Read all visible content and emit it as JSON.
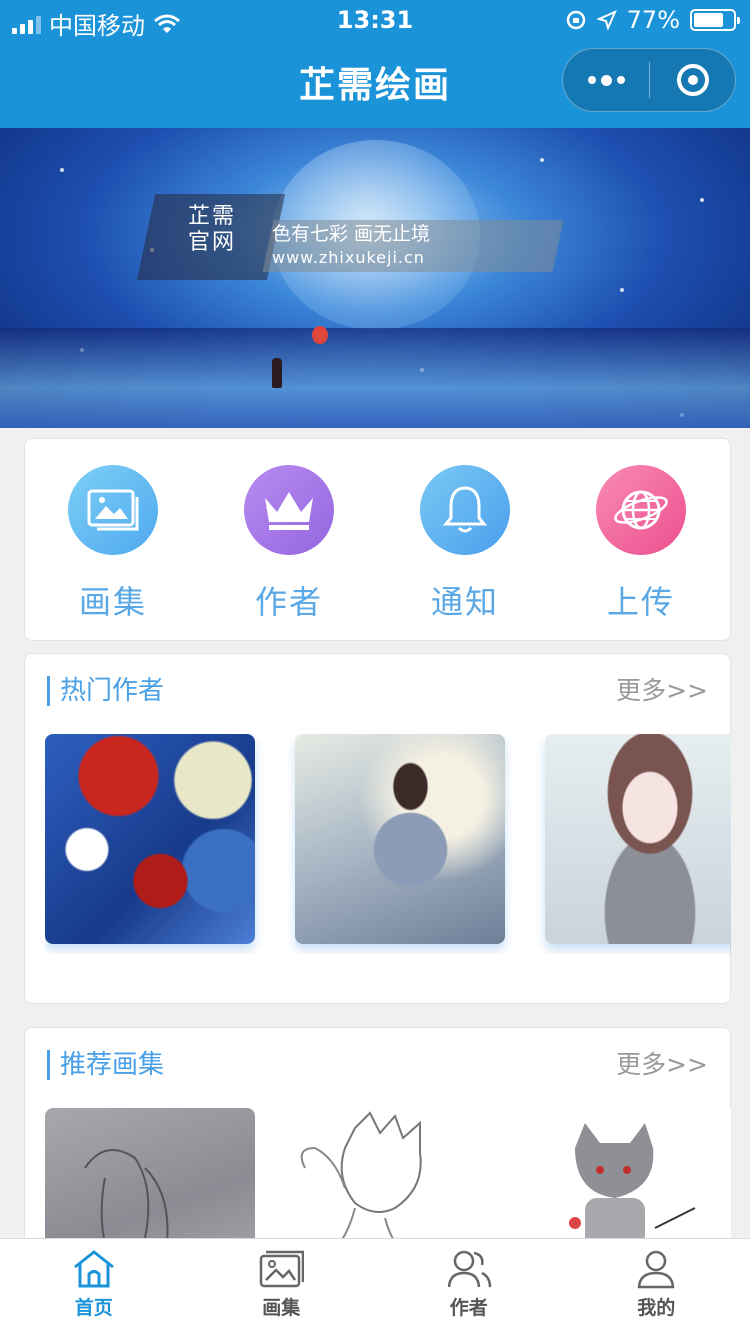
{
  "status": {
    "carrier": "中国移动",
    "time": "13:31",
    "battery": "77%",
    "battery_level": 0.77
  },
  "nav": {
    "title": "芷需绘画"
  },
  "banner": {
    "logo_line1": "芷需",
    "logo_line2": "官网",
    "slogan": "色有七彩  画无止境",
    "url": "www.zhixukeji.cn"
  },
  "menu": [
    {
      "label": "画集",
      "icon": "gallery-icon",
      "color": "#6cc3f2"
    },
    {
      "label": "作者",
      "icon": "crown-icon",
      "color": "#a77ae8"
    },
    {
      "label": "通知",
      "icon": "bell-icon",
      "color": "#5fb4f1"
    },
    {
      "label": "上传",
      "icon": "globe-icon",
      "color": "#f0679e"
    }
  ],
  "hot_authors": {
    "title": "热门作者",
    "more": "更多>>"
  },
  "recommended": {
    "title": "推荐画集",
    "more": "更多>>"
  },
  "tabs": [
    {
      "label": "首页",
      "icon": "home-icon",
      "active": true
    },
    {
      "label": "画集",
      "icon": "gallery-icon",
      "active": false
    },
    {
      "label": "作者",
      "icon": "users-icon",
      "active": false
    },
    {
      "label": "我的",
      "icon": "user-icon",
      "active": false
    }
  ],
  "colors": {
    "primary": "#1a93d9",
    "accent": "#4aa0e6"
  }
}
